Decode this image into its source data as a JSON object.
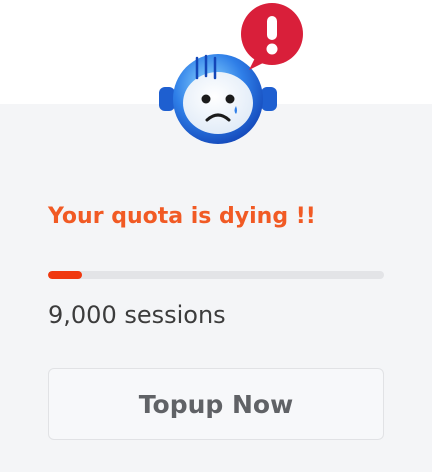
{
  "quota": {
    "warning_title": "Your quota is dying !!",
    "remaining_fraction": 0.1,
    "sessions_text": "9,000 sessions",
    "topup_label": "Topup Now"
  },
  "colors": {
    "warning": "#f15a24",
    "progress_fill": "#f0380f",
    "alert_badge": "#d91f3a"
  },
  "icons": {
    "mascot": "sad-robot-icon",
    "badge": "exclamation-icon"
  }
}
